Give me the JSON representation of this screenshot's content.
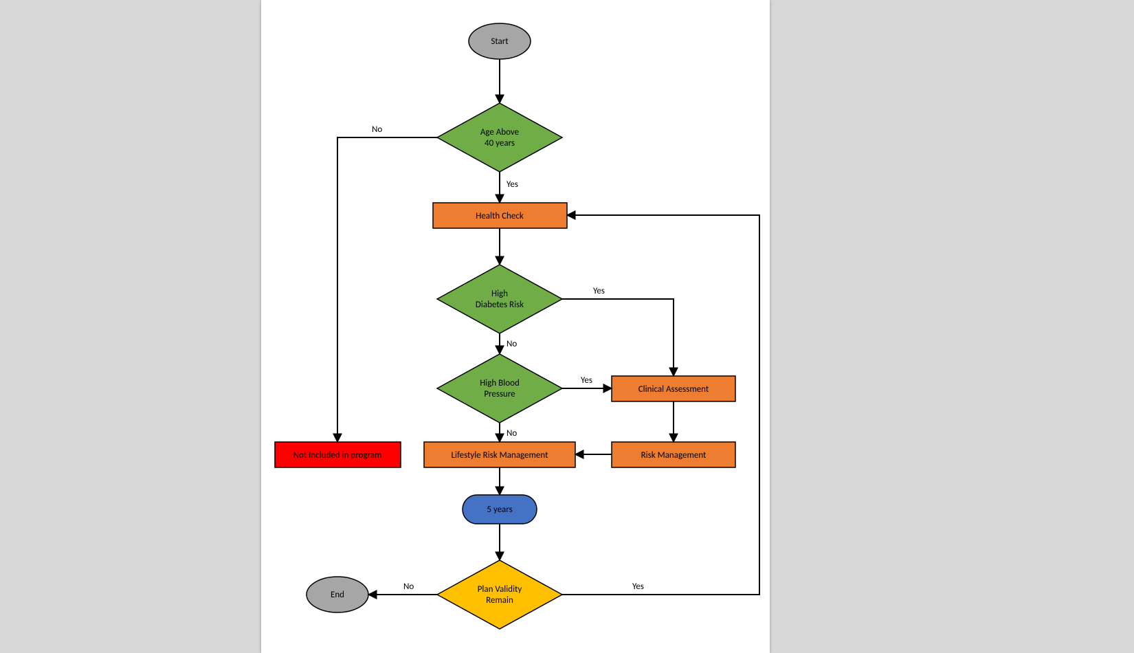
{
  "colors": {
    "gray": "#a6a6a6",
    "green": "#70ad47",
    "orange": "#ed7d31",
    "red": "#ff0000",
    "blue": "#4472c4",
    "gold": "#ffc000",
    "stroke": "#000000"
  },
  "nodes": {
    "start": {
      "label": "Start"
    },
    "age": {
      "label1": "Age Above",
      "label2": "40 years"
    },
    "health": {
      "label": "Health Check"
    },
    "diabetes": {
      "label1": "High",
      "label2": "Diabetes Risk"
    },
    "pressure": {
      "label1": "High Blood",
      "label2": "Pressure"
    },
    "clinical": {
      "label": "Clinical Assessment"
    },
    "lifestyle": {
      "label": "Lifestyle Risk Management"
    },
    "riskmgmt": {
      "label": "Risk Management"
    },
    "notincl": {
      "label": "Not Included in program"
    },
    "fiveyears": {
      "label": "5 years"
    },
    "validity": {
      "label1": "Plan Validity",
      "label2": "Remain"
    },
    "end": {
      "label": "End"
    }
  },
  "edges": {
    "age_no": "No",
    "age_yes": "Yes",
    "diabetes_yes": "Yes",
    "diabetes_no": "No",
    "pressure_yes": "Yes",
    "pressure_no": "No",
    "validity_no": "No",
    "validity_yes": "Yes"
  }
}
